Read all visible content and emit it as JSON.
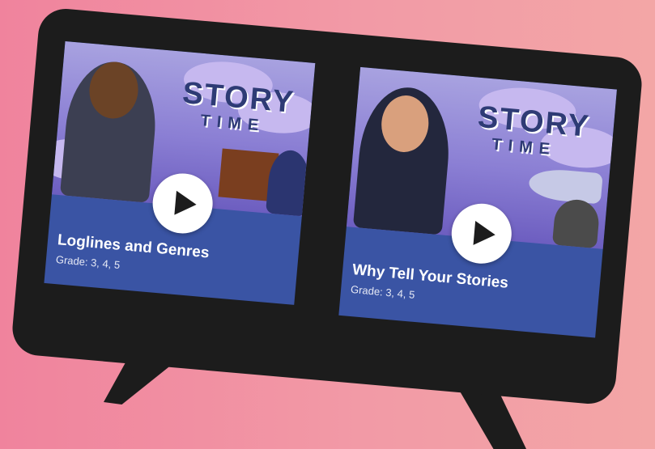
{
  "cards": [
    {
      "logo_top": "STORY",
      "logo_bottom": "TIME",
      "title": "Loglines and Genres",
      "grade": "Grade: 3, 4, 5"
    },
    {
      "logo_top": "STORY",
      "logo_bottom": "TIME",
      "title": "Why Tell Your Stories",
      "grade": "Grade: 3, 4, 5"
    }
  ],
  "colors": {
    "background": "#f0839d",
    "tv": "#1c1c1c",
    "card": "#3a54a4"
  },
  "icons": [
    "play-icon"
  ]
}
